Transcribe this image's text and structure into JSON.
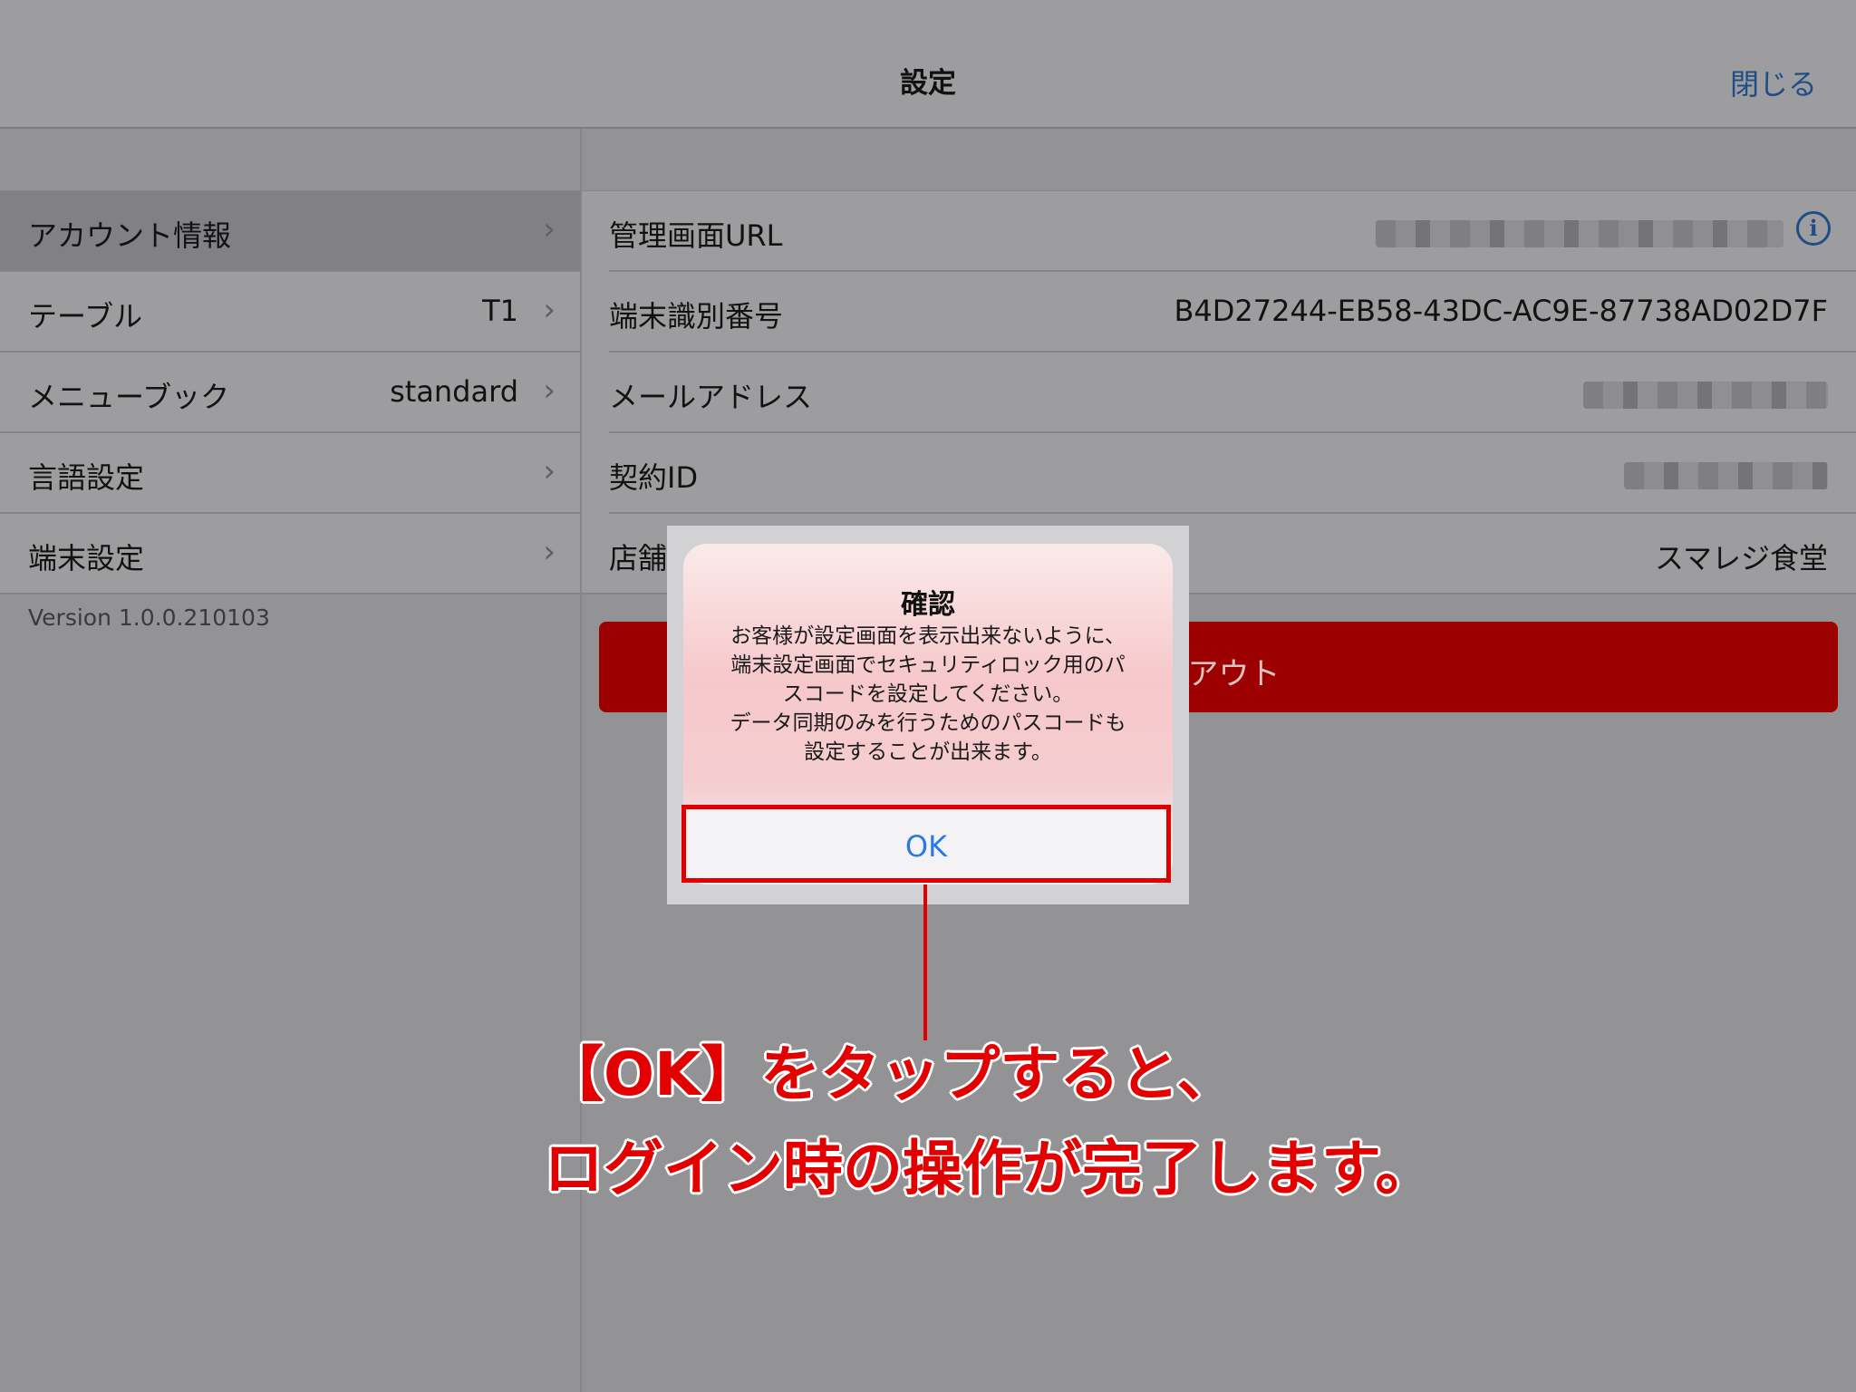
{
  "header": {
    "title": "設定",
    "close_label": "閉じる"
  },
  "sidebar": {
    "items": [
      {
        "label": "アカウント情報",
        "value": ""
      },
      {
        "label": "テーブル",
        "value": "T1"
      },
      {
        "label": "メニューブック",
        "value": "standard"
      },
      {
        "label": "言語設定",
        "value": ""
      },
      {
        "label": "端末設定",
        "value": ""
      }
    ],
    "version": "Version 1.0.0.210103"
  },
  "details": {
    "rows": [
      {
        "label": "管理画面URL",
        "value": ""
      },
      {
        "label": "端末識別番号",
        "value": "B4D27244-EB58-43DC-AC9E-87738AD02D7F"
      },
      {
        "label": "メールアドレス",
        "value": ""
      },
      {
        "label": "契約ID",
        "value": ""
      },
      {
        "label": "店舗",
        "value": "スマレジ食堂"
      }
    ],
    "logout_label": "グアウト"
  },
  "alert": {
    "title": "確認",
    "message_lines": [
      "お客様が設定画面を表示出来ないように、",
      "端末設定画面でセキュリティロック用のパ",
      "スコードを設定してください。",
      "データ同期のみを行うためのパスコードも",
      "設定することが出来ます。"
    ],
    "ok_label": "OK"
  },
  "annotation": {
    "line1": "【OK】をタップすると、",
    "line2": "ログイン時の操作が完了します。"
  },
  "colors": {
    "accent_blue": "#2a7ae2",
    "logout_red": "#9c0000",
    "annotation_red": "#e20000"
  },
  "icons": {
    "chevron": "chevron-right-icon",
    "info": "info-icon"
  }
}
